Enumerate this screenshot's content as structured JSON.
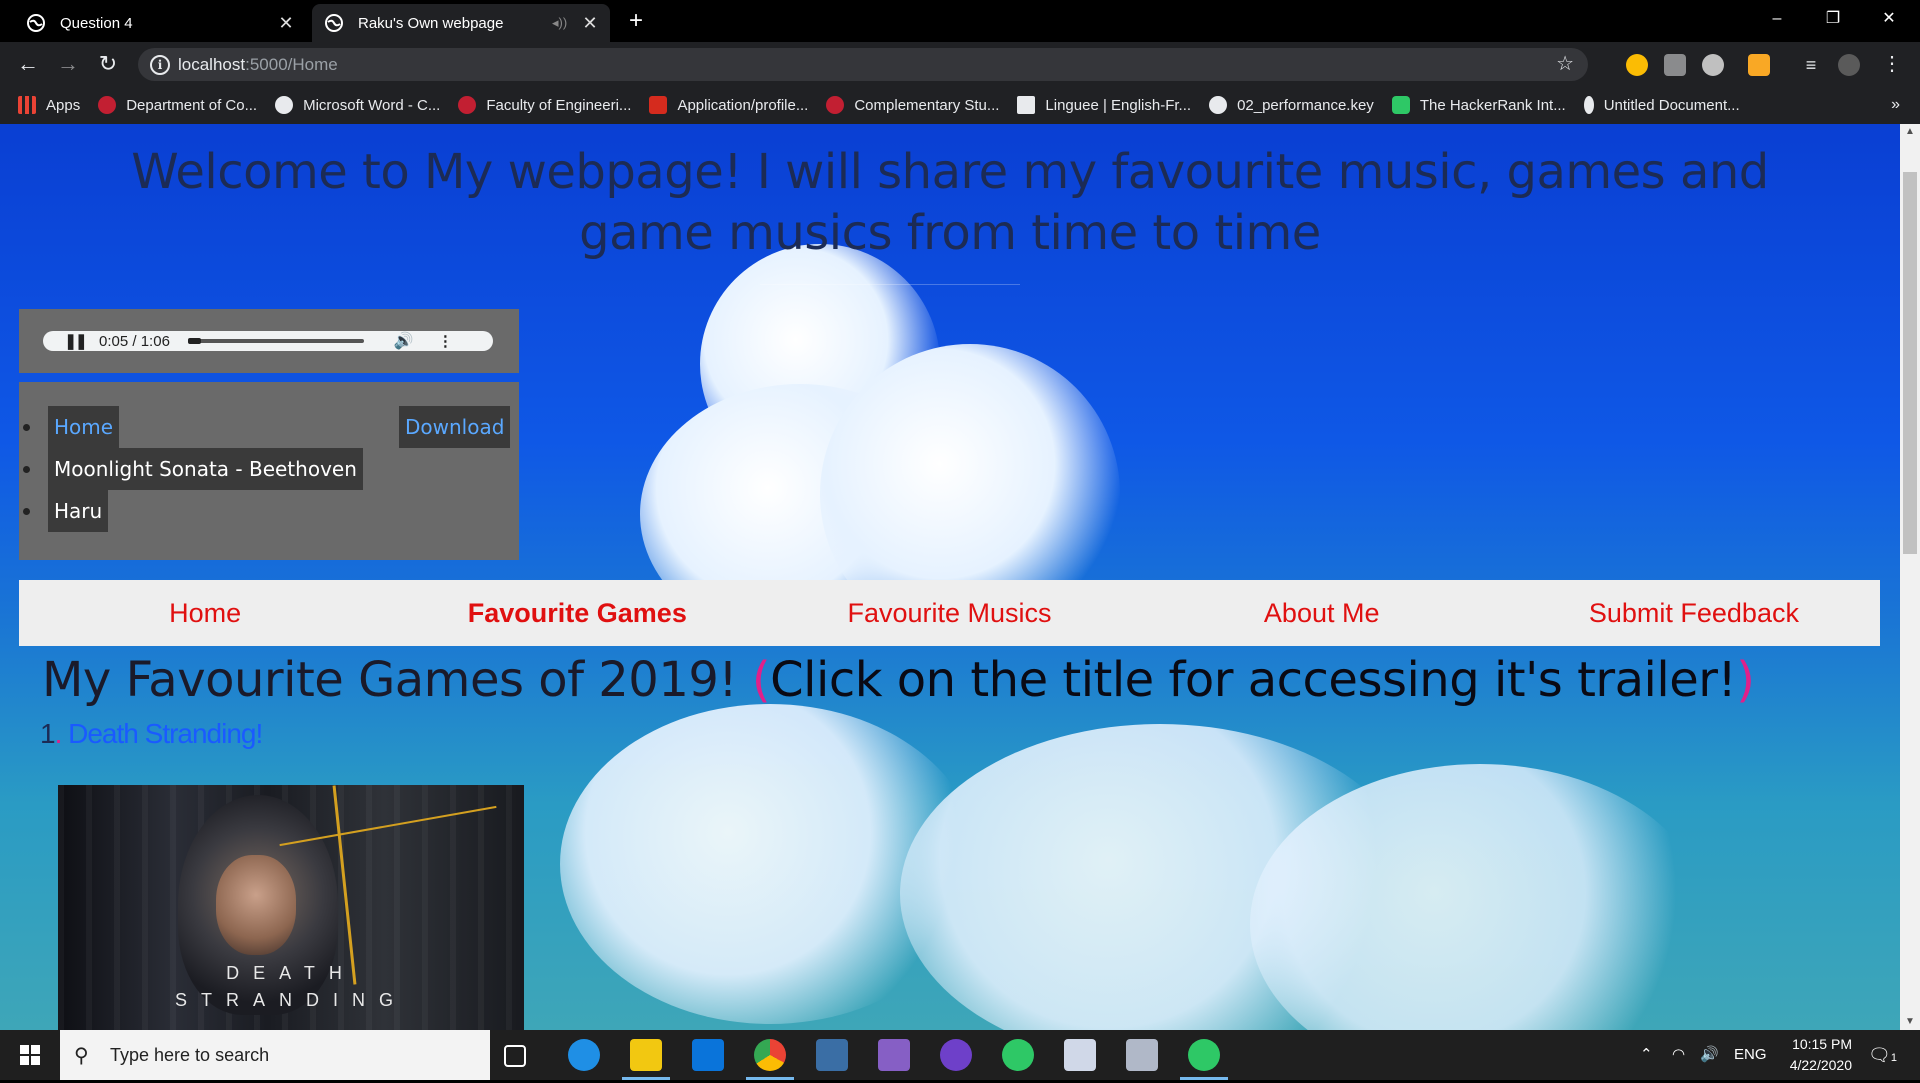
{
  "browser": {
    "tabs": [
      {
        "title": "Question 4",
        "active": false
      },
      {
        "title": "Raku's Own webpage",
        "active": true
      }
    ],
    "new_tab": "+",
    "window_controls": {
      "minimize": "–",
      "restore": "❐",
      "close": "✕"
    },
    "url_host": "localhost",
    "url_rest": ":5000/Home",
    "bookmarks": [
      {
        "label": "Apps",
        "color": "#ea4335"
      },
      {
        "label": "Department of Co...",
        "color": "#c21f32"
      },
      {
        "label": "Microsoft Word - C...",
        "color": "#e8eaed"
      },
      {
        "label": "Faculty of Engineeri...",
        "color": "#c21f32"
      },
      {
        "label": "Application/profile...",
        "color": "#d52b1e"
      },
      {
        "label": "Complementary Stu...",
        "color": "#c21f32"
      },
      {
        "label": "Linguee | English-Fr...",
        "color": "#e8eaed"
      },
      {
        "label": "02_performance.key",
        "color": "#e8eaed"
      },
      {
        "label": "The HackerRank Int...",
        "color": "#2ec866"
      },
      {
        "label": "Untitled Document...",
        "color": "#e8eaed"
      }
    ],
    "bookmarks_more": "»"
  },
  "page": {
    "welcome": "Welcome to My webpage! I will share my favourite music, games and game musics from time to time",
    "player": {
      "current": "0:05",
      "duration": "1:06",
      "progress": 0.076
    },
    "playlist": {
      "home": "Home",
      "download": "Download",
      "items": [
        "Moonlight Sonata - Beethoven",
        "Haru"
      ]
    },
    "nav": [
      "Home",
      "Favourite Games",
      "Favourite Musics",
      "About Me",
      "Submit Feedback"
    ],
    "active_nav": "Favourite Games",
    "section_title": "My Favourite Games of 2019! ",
    "section_paren_open": "(",
    "section_hint": "Click on the title for accessing it's trailer!",
    "section_paren_close": ")",
    "games": [
      {
        "number": "1",
        "dot": ".",
        "title": "Death Stranding!"
      }
    ],
    "game_logo_line1": "DEATH",
    "game_logo_line2": "STRANDING"
  },
  "taskbar": {
    "search_placeholder": "Type here to search",
    "language": "ENG",
    "time": "10:15 PM",
    "date": "4/22/2020",
    "notification_count": "1"
  },
  "colors": {
    "nav_text": "#e01010",
    "link": "#1a5aff",
    "accent_pink": "#e0208a"
  }
}
